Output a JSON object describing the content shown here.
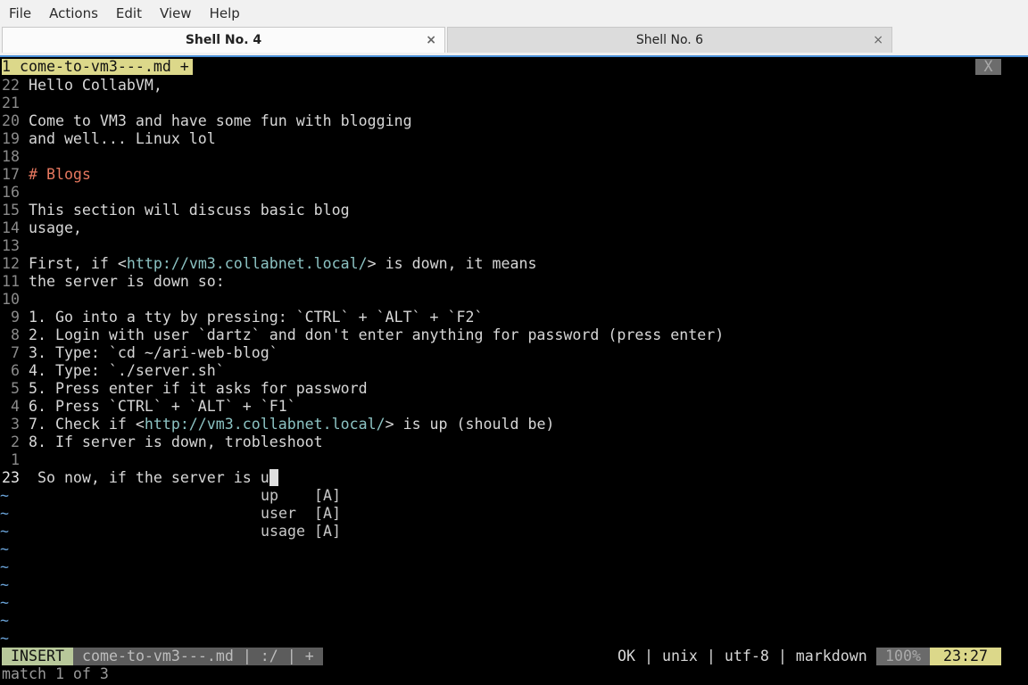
{
  "menu": [
    "File",
    "Actions",
    "Edit",
    "View",
    "Help"
  ],
  "tabs": [
    {
      "label": "Shell No. 4",
      "close": "×"
    },
    {
      "label": "Shell No. 6",
      "close": "×"
    }
  ],
  "buffer_tab": {
    "label": "1 come-to-vm3---.md +",
    "close": "X"
  },
  "lines": [
    {
      "n": "22",
      "t": "Hello CollabVM,"
    },
    {
      "n": "21",
      "t": ""
    },
    {
      "n": "20",
      "t": "Come to VM3 and have some fun with blogging"
    },
    {
      "n": "19",
      "t": "and well... Linux lol"
    },
    {
      "n": "18",
      "t": ""
    },
    {
      "n": "17",
      "t": "# Blogs",
      "cls": "hdr"
    },
    {
      "n": "16",
      "t": ""
    },
    {
      "n": "15",
      "t": "This section will discuss basic blog"
    },
    {
      "n": "14",
      "t": "usage,"
    },
    {
      "n": "13",
      "t": ""
    },
    {
      "n": "12",
      "pre": "First, if <",
      "url": "http://vm3.collabnet.local/",
      "post": "> is down, it means"
    },
    {
      "n": "11",
      "t": "the server is down so:"
    },
    {
      "n": "10",
      "t": ""
    },
    {
      "n": " 9",
      "t": "1. Go into a tty by pressing: `CTRL` + `ALT` + `F2`"
    },
    {
      "n": " 8",
      "t": "2. Login with user `dartz` and don't enter anything for password (press enter)"
    },
    {
      "n": " 7",
      "t": "3. Type: `cd ~/ari-web-blog`"
    },
    {
      "n": " 6",
      "t": "4. Type: `./server.sh`"
    },
    {
      "n": " 5",
      "t": "5. Press enter if it asks for password"
    },
    {
      "n": " 4",
      "t": "6. Press `CTRL` + `ALT` + `F1`"
    },
    {
      "n": " 3",
      "pre": "7. Check if <",
      "url": "http://vm3.collabnet.local/",
      "post": "> is up (should be)"
    },
    {
      "n": " 2",
      "t": "8. If server is down, trobleshoot"
    },
    {
      "n": " 1",
      "t": ""
    }
  ],
  "current_line": {
    "n": "23",
    "t": "So now, if the server is u"
  },
  "completion": [
    {
      "word": "up",
      "kind": "[A]"
    },
    {
      "word": "user",
      "kind": "[A]"
    },
    {
      "word": "usage",
      "kind": "[A]"
    }
  ],
  "tilde": "~",
  "status": {
    "mode": "INSERT",
    "file": "come-to-vm3---.md | :/ | +",
    "info": "OK | unix | utf-8 | markdown",
    "percent": "100%",
    "position": "23:27"
  },
  "message": "match 1 of 3"
}
